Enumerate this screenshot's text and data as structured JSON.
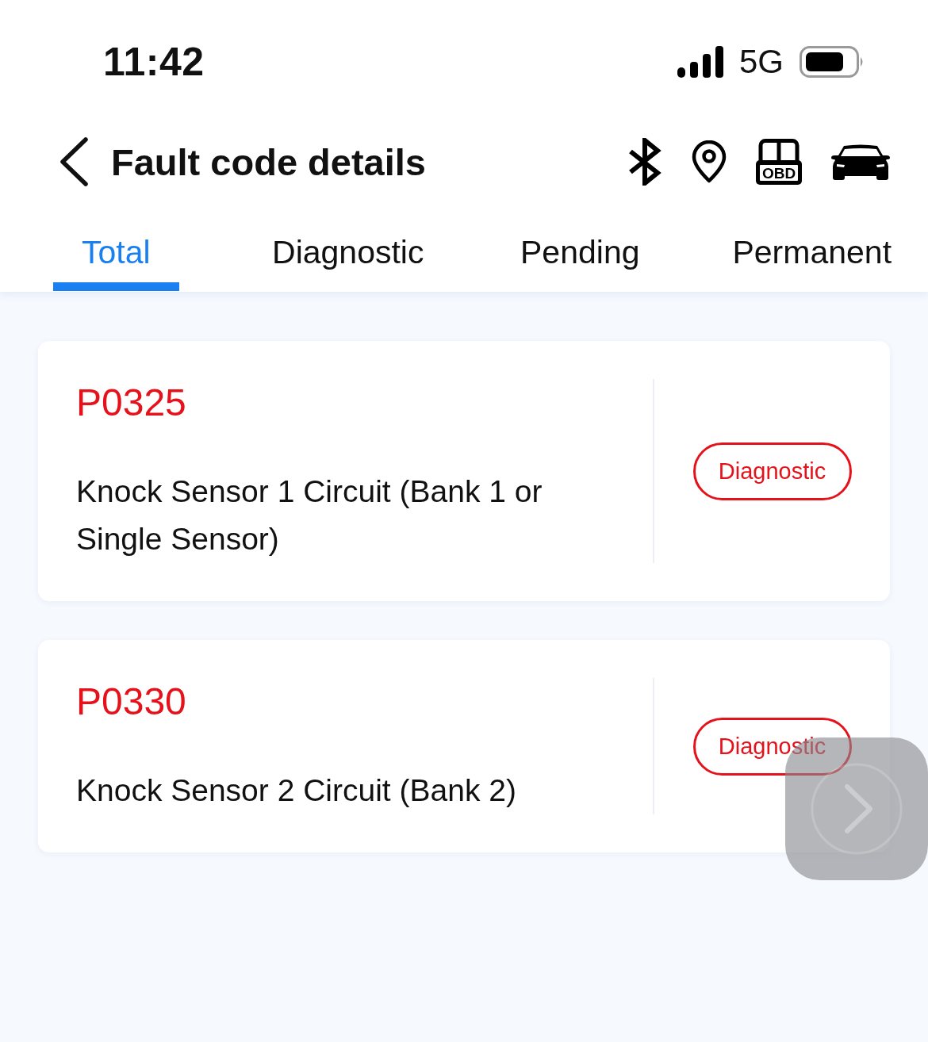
{
  "status_bar": {
    "time": "11:42",
    "network": "5G"
  },
  "header": {
    "title": "Fault code details",
    "obd_label": "OBD"
  },
  "tabs": [
    {
      "label": "Total",
      "selected": true
    },
    {
      "label": "Diagnostic",
      "selected": false
    },
    {
      "label": "Pending",
      "selected": false
    },
    {
      "label": "Permanent",
      "selected": false
    }
  ],
  "faults": [
    {
      "code": "P0325",
      "description": "Knock Sensor 1 Circuit (Bank 1 or Single Sensor)",
      "status": "Diagnostic"
    },
    {
      "code": "P0330",
      "description": "Knock Sensor 2 Circuit (Bank 2)",
      "status": "Diagnostic"
    }
  ]
}
